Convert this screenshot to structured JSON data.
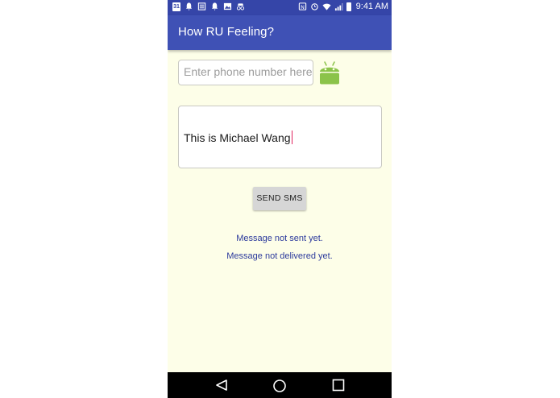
{
  "statusbar": {
    "calendar_day": "31",
    "time": "9:41 AM",
    "left_icons": [
      "calendar-icon",
      "notification-bell-icon",
      "list-icon",
      "notification-bell-icon",
      "image-icon",
      "incognito-icon"
    ],
    "right_icons": [
      "nfc-icon",
      "alarm-icon",
      "wifi-icon",
      "signal-icon",
      "battery-icon"
    ]
  },
  "appbar": {
    "title": "How RU Feeling?"
  },
  "phone_field": {
    "placeholder": "Enter phone number here",
    "value": ""
  },
  "message_field": {
    "value": "This is Michael Wang"
  },
  "send_button": {
    "label": "SEND SMS"
  },
  "status": {
    "sent": "Message not sent yet.",
    "delivered": "Message not delivered yet."
  },
  "colors": {
    "appbar": "#3f51b5",
    "statusbar": "#3545a8",
    "background": "#fdfee8",
    "status_text": "#2c3a9c",
    "android_green": "#8bc34a"
  },
  "navbar": {
    "icons": [
      "back-icon",
      "home-icon",
      "recents-icon"
    ]
  }
}
